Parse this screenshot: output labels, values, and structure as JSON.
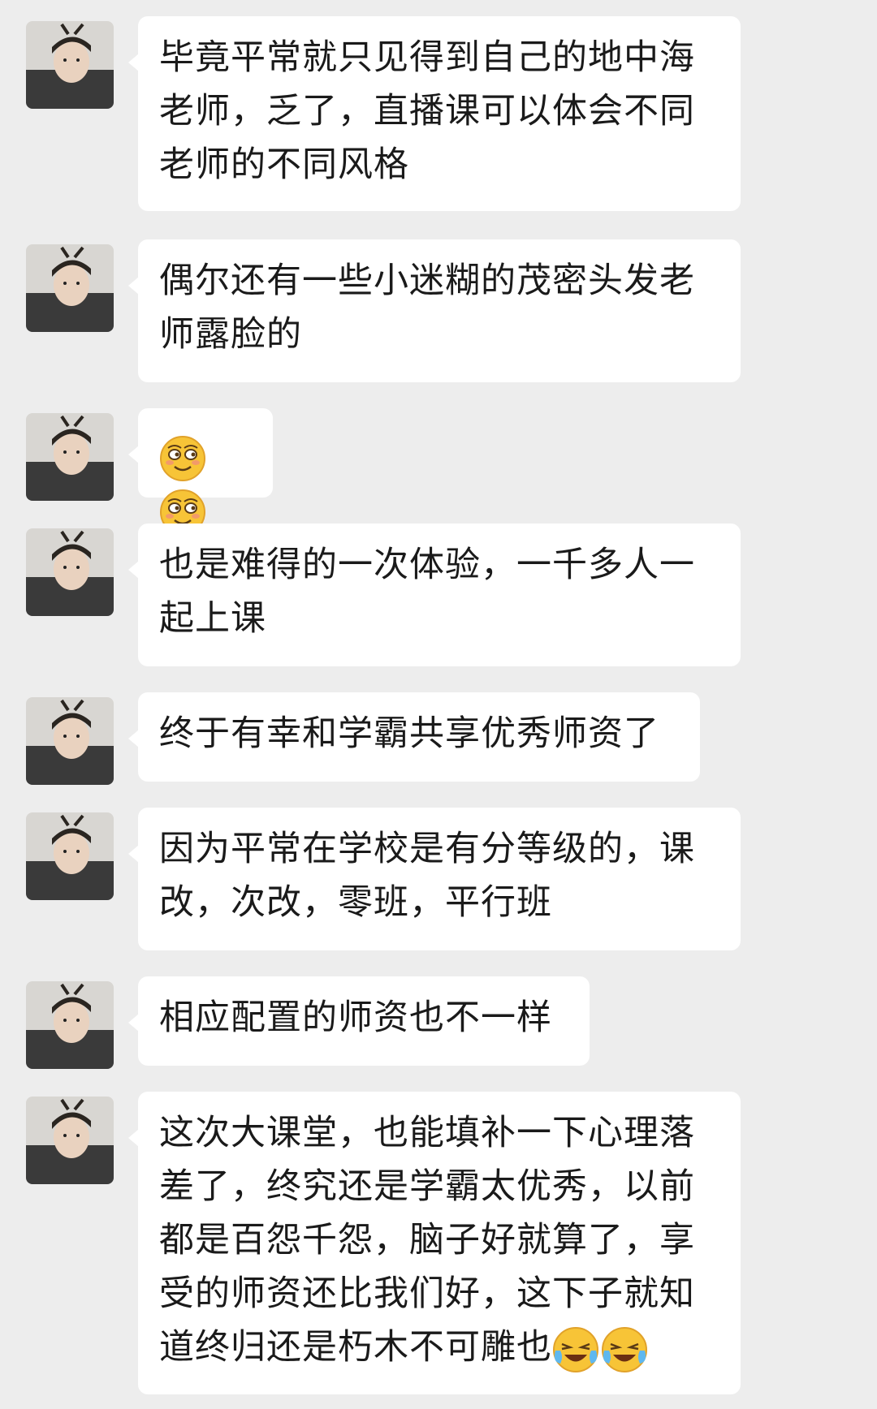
{
  "messages": [
    {
      "text": "毕竟平常就只见得到自己的地中海老师，乏了，直播课可以体会不同老师的不同风格",
      "emojis": []
    },
    {
      "text": "偶尔还有一些小迷糊的茂密头发老师露脸的",
      "emojis": []
    },
    {
      "text": "",
      "emojis": [
        "squint-smirk-emoji",
        "squint-smirk-emoji"
      ]
    },
    {
      "text": "也是难得的一次体验，一千多人一起上课",
      "emojis": []
    },
    {
      "text": "终于有幸和学霸共享优秀师资了",
      "emojis": []
    },
    {
      "text": "因为平常在学校是有分等级的，课改，次改，零班，平行班",
      "emojis": []
    },
    {
      "text": "相应配置的师资也不一样",
      "emojis": []
    },
    {
      "text": "这次大课堂，也能填补一下心理落差了，终究还是学霸太优秀，以前都是百怨千怨，脑子好就算了，享受的师资还比我们好，这下子就知道终归还是朽木不可雕也",
      "emojis": [
        "crying-laughing-emoji",
        "crying-laughing-emoji"
      ]
    }
  ]
}
